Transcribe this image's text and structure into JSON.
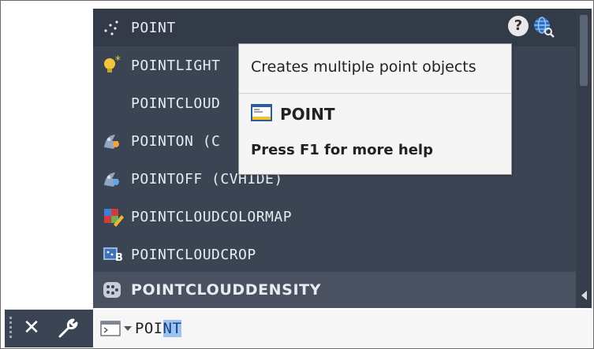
{
  "autocomplete": {
    "items": [
      {
        "label": "POINT",
        "icon": "multipoint-icon"
      },
      {
        "label": "POINTLIGHT",
        "icon": "point-light-icon"
      },
      {
        "label": "POINTCLOUD",
        "icon": ""
      },
      {
        "label": "POINTON (C",
        "icon": "point-on-icon"
      },
      {
        "label": "POINTOFF (CVHIDE)",
        "icon": "point-off-icon"
      },
      {
        "label": "POINTCLOUDCOLORMAP",
        "icon": "colormap-icon"
      },
      {
        "label": "POINTCLOUDCROP",
        "icon": "crop-icon"
      },
      {
        "label": "POINTCLOUDDENSITY",
        "icon": "density-icon"
      }
    ],
    "help_icon_glyph": "?",
    "colors": {
      "list_bg": "#3b4453",
      "selected_bg": "#4a5262",
      "text": "#e8ecf0"
    }
  },
  "tooltip": {
    "description": "Creates multiple point objects",
    "command_name": "POINT",
    "help_hint": "Press F1 for more help"
  },
  "command_line": {
    "close_glyph": "✕",
    "typed_prefix": "POI",
    "typed_highlight": "NT",
    "highlight_color": "#9cc2ee"
  }
}
